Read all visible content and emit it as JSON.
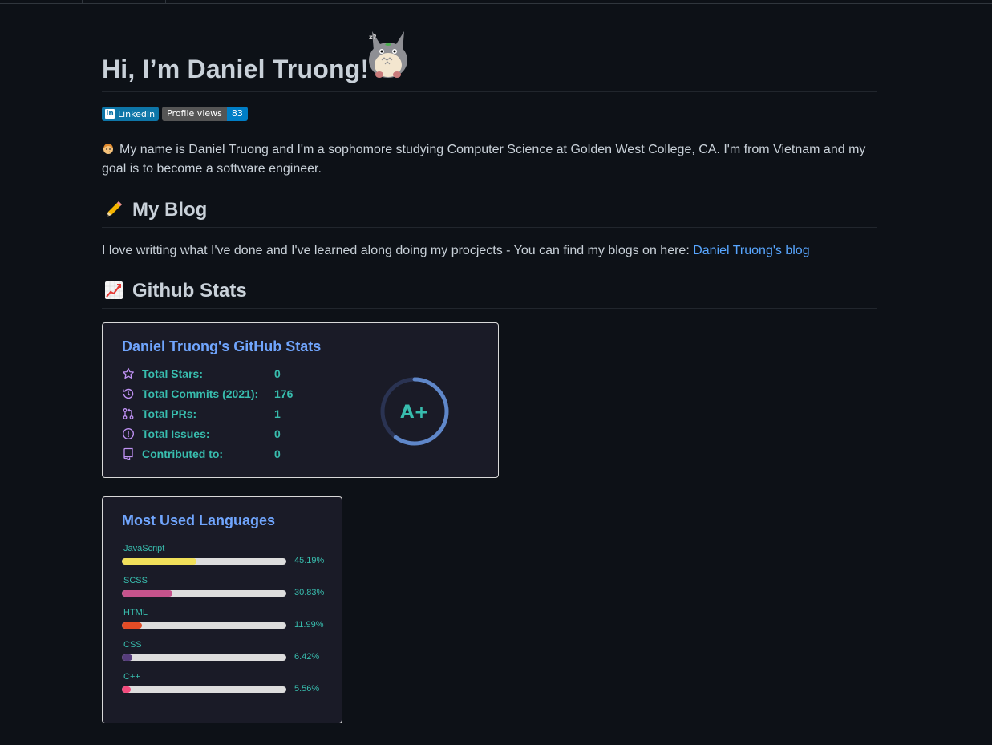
{
  "header": {
    "title": "Hi, I’m Daniel Truong!"
  },
  "badges": {
    "linkedin": "LinkedIn",
    "views_label": "Profile views",
    "views_count": "83"
  },
  "intro": {
    "text": "My name is Daniel Truong and I'm a sophomore studying Computer Science at Golden West College, CA. I'm from Vietnam and my goal is to become a software engineer."
  },
  "blog": {
    "heading": "My Blog",
    "text": "I love writting what I've done and I've learned along doing my procjects - You can find my blogs on here: ",
    "link": "Daniel Truong's blog"
  },
  "stats": {
    "heading": "Github Stats",
    "card_title": "Daniel Truong's GitHub Stats",
    "rows": [
      {
        "label": "Total Stars:",
        "value": "0"
      },
      {
        "label": "Total Commits (2021):",
        "value": "176"
      },
      {
        "label": "Total PRs:",
        "value": "1"
      },
      {
        "label": "Total Issues:",
        "value": "0"
      },
      {
        "label": "Contributed to:",
        "value": "0"
      }
    ],
    "rank": "A+",
    "rank_progress": 0.6
  },
  "languages": {
    "title": "Most Used Languages",
    "items": [
      {
        "name": "JavaScript",
        "pct_label": "45.19%",
        "pct": 45.19,
        "color": "#f1e05a"
      },
      {
        "name": "SCSS",
        "pct_label": "30.83%",
        "pct": 30.83,
        "color": "#c6538c"
      },
      {
        "name": "HTML",
        "pct_label": "11.99%",
        "pct": 11.99,
        "color": "#e34c26"
      },
      {
        "name": "CSS",
        "pct_label": "6.42%",
        "pct": 6.42,
        "color": "#563d7c"
      },
      {
        "name": "C++",
        "pct_label": "5.56%",
        "pct": 5.56,
        "color": "#f34b7d"
      }
    ]
  },
  "colors": {
    "background": "#0d1117",
    "card_background": "#1a1b27",
    "card_title": "#70a5fd",
    "card_text": "#38bdae",
    "link": "#58a6ff"
  }
}
